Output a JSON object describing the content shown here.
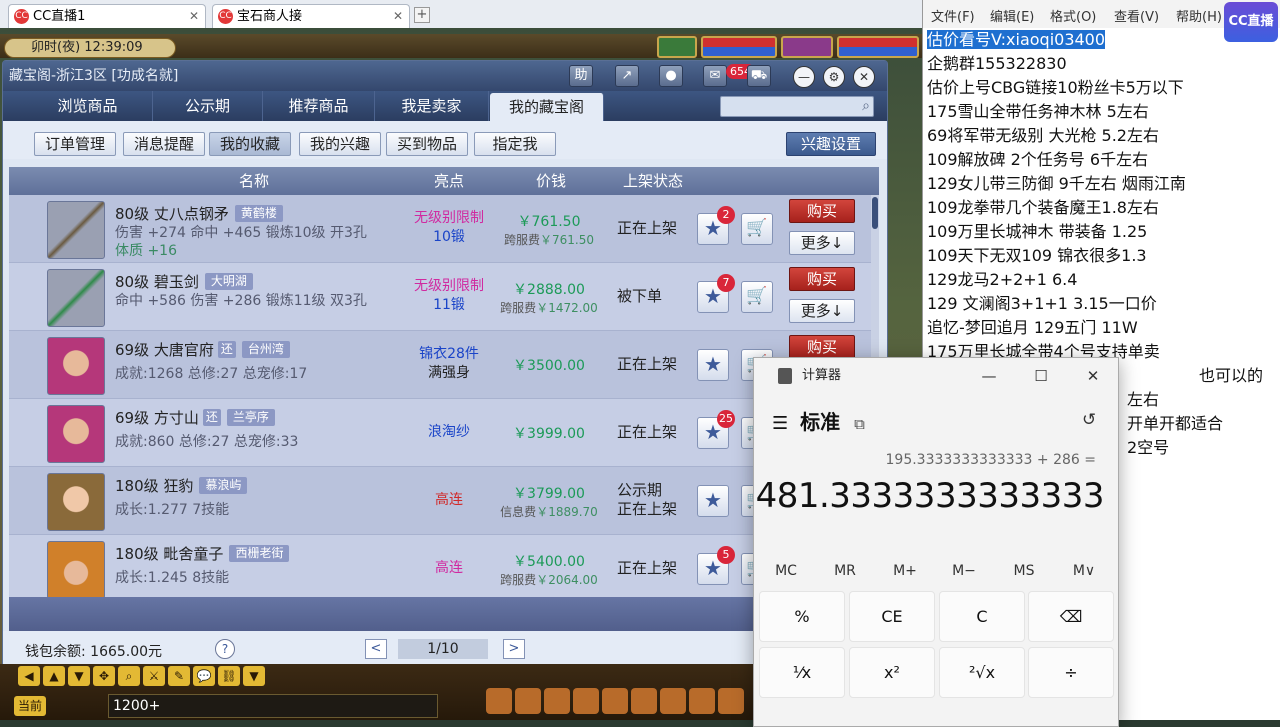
{
  "browser": {
    "tabs": [
      {
        "label": "CC直播1",
        "favicon": "CC"
      },
      {
        "label": "宝石商人接",
        "favicon": "CC"
      }
    ],
    "add_tab": "+"
  },
  "game": {
    "time": "卯时(夜) 12:39:09",
    "chat_input": "1200+",
    "current_label": "当前"
  },
  "window": {
    "title": "藏宝阁-浙江3区 [功成名就]",
    "help_btn": "助",
    "message_count": "654",
    "nav_tabs": [
      "浏览商品",
      "公示期",
      "推荐商品",
      "我是卖家",
      "我的藏宝阁"
    ],
    "active_nav": "我的藏宝阁",
    "search_placeholder": "",
    "sub_buttons": [
      "订单管理",
      "消息提醒",
      "我的收藏",
      "我的兴趣",
      "买到物品",
      "指定我"
    ],
    "active_sub": "我的收藏",
    "interest_setting": "兴趣设置",
    "columns": [
      "名称",
      "亮点",
      "价钱",
      "上架状态"
    ],
    "rows": [
      {
        "level": "80级",
        "name": "丈八点钢矛",
        "server": "黄鹤楼",
        "attr_line1": "伤害 +274 命中 +465 锻炼10级 开3孔",
        "attr_line2": "体质 +16",
        "highlight_red": "无级别限制",
        "highlight_blue": "10锻",
        "price": "￥761.50",
        "fee_label": "跨服费",
        "fee": "￥761.50",
        "status": "正在上架",
        "star_count": "2",
        "buy": "购买",
        "more": "更多↓"
      },
      {
        "level": "80级",
        "name": "碧玉剑",
        "server": "大明湖",
        "attr_line1": "命中 +586 伤害 +286 锻炼11级 双3孔",
        "attr_line2": "",
        "highlight_red": "无级别限制",
        "highlight_blue": "11锻",
        "price": "￥2888.00",
        "fee_label": "跨服费",
        "fee": "￥1472.00",
        "status": "被下单",
        "star_count": "7",
        "buy": "购买",
        "more": "更多↓"
      },
      {
        "level": "69级",
        "name": "大唐官府",
        "badge": "还",
        "server": "台州湾",
        "attr_line1": "成就:1268 总修:27 总宠修:17",
        "highlight_blue": "锦衣28件",
        "highlight_black": "满强身",
        "price": "￥3500.00",
        "status": "正在上架",
        "buy": "购买"
      },
      {
        "level": "69级",
        "name": "方寸山",
        "badge": "还",
        "server": "兰亭序",
        "attr_line1": "成就:860 总修:27 总宠修:33",
        "highlight_blue": "浪淘纱",
        "price": "￥3999.00",
        "status": "正在上架",
        "star_count": "25"
      },
      {
        "level": "180级",
        "name": "狂豹",
        "server": "慕浪屿",
        "attr_line1": "成长:1.277 7技能",
        "highlight_red": "高连",
        "price": "￥3799.00",
        "fee_label": "信息费",
        "fee": "￥1889.70",
        "status": "公示期",
        "status2": "正在上架"
      },
      {
        "level": "180级",
        "name": "毗舍童子",
        "server": "西栅老街",
        "attr_line1": "成长:1.245 8技能",
        "highlight_red": "高连",
        "price": "￥5400.00",
        "fee_label": "跨服费",
        "fee": "￥2064.00",
        "status": "正在上架",
        "star_count": "5"
      }
    ],
    "wallet": "钱包余额: 1665.00元",
    "help": "?",
    "page": "1/10",
    "prev": "<",
    "next": ">"
  },
  "notepad": {
    "menu": [
      "文件(F)",
      "编辑(E)",
      "格式(O)",
      "查看(V)",
      "帮助(H)"
    ],
    "lines": [
      "估价看号V:xiaoqi03400",
      "企鹅群155322830",
      "估价上号CBG链接10粉丝卡5万以下",
      "175雪山全带任务神木林 5左右",
      "69将军带无级别 大光枪 5.2左右",
      "109解放碑 2个任务号 6千左右",
      "129女儿带三防御 9千左右 烟雨江南",
      "109龙拳带几个装备魔王1.8左右",
      "109万里长城神木 带装备 1.25",
      "109天下无双109 锦衣很多1.3",
      "129龙马2+2+1 6.4",
      "129 文澜阁3+1+1  3.15一口价",
      "追忆-梦回追月 129五门 11W",
      "175万里长城全带4个号支持单卖",
      "也可以的",
      "左右",
      "开单开都适合",
      "2空号"
    ],
    "logo": "CC直播"
  },
  "calculator": {
    "title": "计算器",
    "mode": "标准",
    "expression": "195.3333333333333 + 286 =",
    "result": "481.3333333333333",
    "memory": [
      "MC",
      "MR",
      "M+",
      "M−",
      "MS",
      "M∨"
    ],
    "keys": [
      "%",
      "CE",
      "C",
      "⌫",
      "¹⁄x",
      "x²",
      "²√x",
      "÷"
    ]
  },
  "colors": {
    "accent": "#3d5682",
    "buy": "#c0332b",
    "price": "#1c9a58",
    "selection": "#1e6fd0"
  }
}
